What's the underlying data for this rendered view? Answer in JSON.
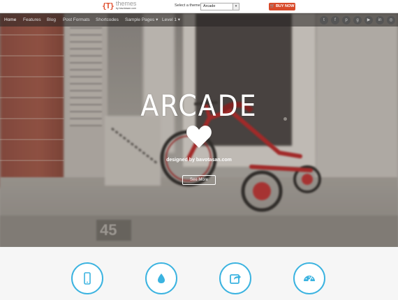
{
  "topbar": {
    "logo_mark": "{T}",
    "logo_word": "themes",
    "logo_sub": "by bavotasan.com",
    "select_label": "Select a theme:",
    "selected_theme": "Arcade",
    "buy_label": "BUY NOW"
  },
  "nav": {
    "items": [
      {
        "label": "Home"
      },
      {
        "label": "Features"
      },
      {
        "label": "Blog"
      },
      {
        "label": "Post Formats"
      },
      {
        "label": "Shortcodes"
      },
      {
        "label": "Sample Pages ▾"
      },
      {
        "label": "Level 1 ▾"
      }
    ],
    "social": [
      "twitter-icon",
      "facebook-icon",
      "pinterest-icon",
      "google-plus-icon",
      "youtube-icon",
      "linkedin-icon",
      "instagram-icon"
    ]
  },
  "hero": {
    "title": "ARCADE",
    "byline": "designed by bavotasan.com",
    "button_label": "See More",
    "plate_number": "45"
  },
  "features": [
    "mobile-icon",
    "droplet-icon",
    "share-icon",
    "dashboard-icon"
  ],
  "colors": {
    "accent": "#3bb3e0",
    "buy_button": "#d84a2a",
    "logo_mark": "#e0502f"
  }
}
